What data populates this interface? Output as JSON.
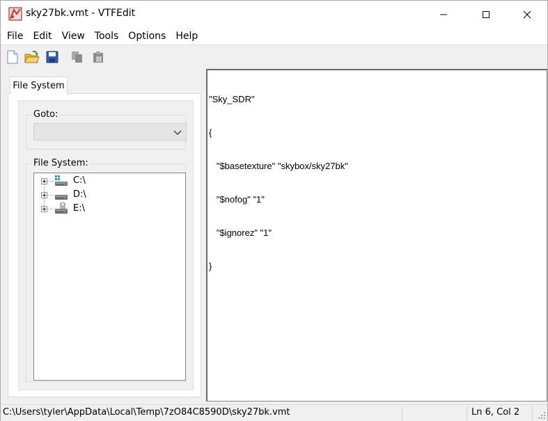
{
  "window": {
    "title": "sky27bk.vmt - VTFEdit"
  },
  "menu": {
    "items": [
      "File",
      "Edit",
      "View",
      "Tools",
      "Options",
      "Help"
    ]
  },
  "toolbar": {
    "buttons": [
      "new-file-icon",
      "open-folder-icon",
      "save-icon",
      "copy-icon",
      "paste-icon"
    ]
  },
  "left_panel": {
    "tab_label": "File System",
    "goto": {
      "label": "Goto:",
      "value": ""
    },
    "file_system": {
      "label": "File System:",
      "drives": [
        {
          "label": "C:\\",
          "icon": "system-drive-icon"
        },
        {
          "label": "D:\\",
          "icon": "drive-icon"
        },
        {
          "label": "E:\\",
          "icon": "locked-drive-icon"
        }
      ]
    }
  },
  "editor": {
    "lines": [
      "\"Sky_SDR\"",
      "{",
      "   \"$basetexture\" \"skybox/sky27bk\"",
      "   \"$nofog\" \"1\"",
      "   \"$ignorez\" \"1\"",
      "}"
    ]
  },
  "status": {
    "path": "C:\\Users\\tyler\\AppData\\Local\\Temp\\7zO84C8590D\\sky27bk.vmt",
    "position": "Ln 6, Col 2"
  },
  "colors": {
    "window_bg": "#f0f0f0",
    "title_bg": "#ffffff",
    "editor_bg": "#ffffff",
    "icon_red": "#c0392b",
    "icon_blue": "#2b5fb0",
    "folder_yellow": "#e8b83a"
  }
}
